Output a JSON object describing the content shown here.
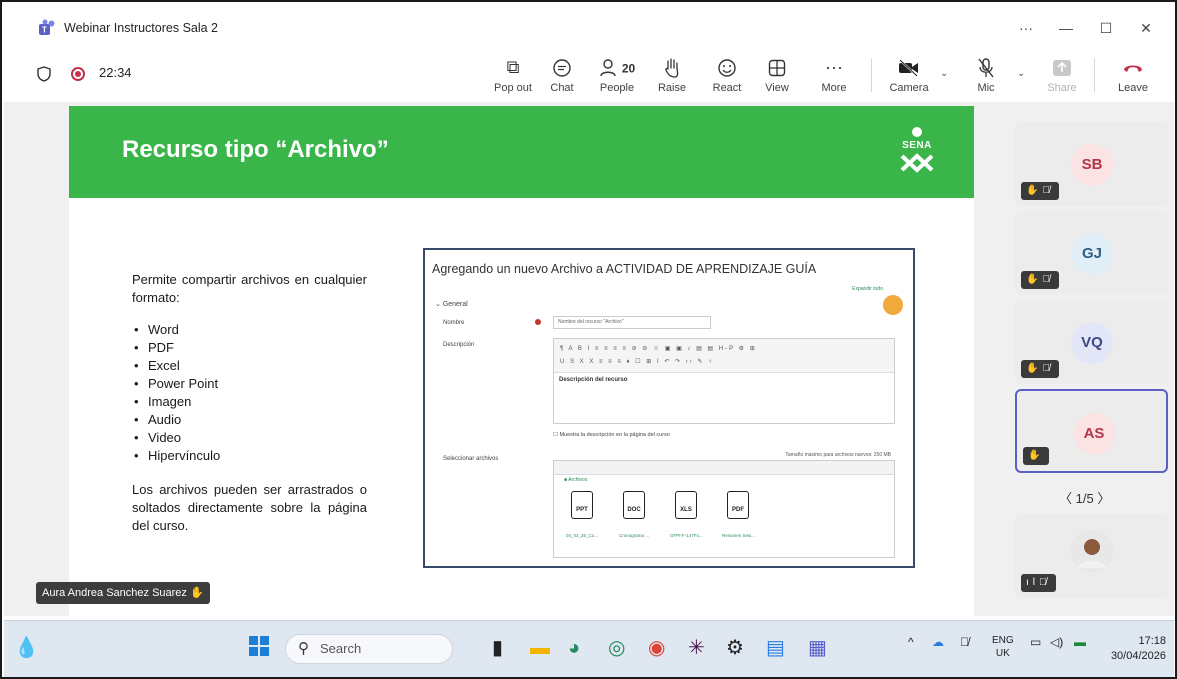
{
  "window": {
    "title": "Webinar Instructores Sala 2",
    "controls": [
      "···",
      "—",
      "☐",
      "✕"
    ]
  },
  "meeting": {
    "timer": "22:34",
    "buttons": [
      {
        "label": "Pop out",
        "icon": "pop-out-icon",
        "glyph": "⧉"
      },
      {
        "label": "Chat",
        "icon": "chat-icon",
        "glyph": "💬"
      },
      {
        "label": "People",
        "icon": "people-icon",
        "glyph": "👥",
        "count": "20"
      },
      {
        "label": "Raise",
        "icon": "raise-hand-icon",
        "glyph": "✋"
      },
      {
        "label": "React",
        "icon": "react-icon",
        "glyph": "☺"
      },
      {
        "label": "View",
        "icon": "view-icon",
        "glyph": "⊞"
      },
      {
        "label": "More",
        "icon": "more-icon",
        "glyph": "···"
      },
      {
        "label": "Camera",
        "icon": "camera-off-icon",
        "glyph": "📷"
      },
      {
        "label": "Mic",
        "icon": "mic-off-icon",
        "glyph": "🎙"
      },
      {
        "label": "Share",
        "icon": "share-icon",
        "glyph": "⇧"
      },
      {
        "label": "Leave",
        "icon": "leave-icon",
        "glyph": "☎"
      }
    ]
  },
  "slide": {
    "title": "Recurso tipo “Archivo”",
    "logo_text": "SENA",
    "intro": "Permite compartir archivos en cualquier formato:",
    "bullets": [
      "Word",
      "PDF",
      "Excel",
      "Power Point",
      "Imagen",
      "Audio",
      "Video",
      "Hipervínculo"
    ],
    "outro": "Los archivos pueden ser arrastrados o soltados directamente sobre la página del curso.",
    "moodle": {
      "heading": "Agregando un nuevo Archivo a ACTIVIDAD DE APRENDIZAJE GUÍA",
      "expand": "Expandir todo",
      "section": "General",
      "name_label": "Nombre",
      "name_value": "Nombre del recurso \"Archivo\"",
      "desc_label": "Descripción",
      "desc_value": "Descripción del recurso",
      "show_desc": "Muestra la descripción en la página del curso",
      "files_label": "Seleccionar archivos",
      "max_size": "Tamaño máximo para archivos nuevos: 250 MB",
      "folder": "Archivos",
      "files": [
        {
          "type": "PPT",
          "name": "04_03_26_Co..."
        },
        {
          "type": "DOC",
          "name": "Cronograma ..."
        },
        {
          "type": "XLS",
          "name": "GFPI-F-147Fo..."
        },
        {
          "type": "PDF",
          "name": "Resumen Sesi..."
        }
      ]
    }
  },
  "speaker_tag": "Aura Andrea Sanchez Suarez",
  "participants": [
    {
      "initials": "SB",
      "color": "#fbe3e3",
      "text_color": "#b3344b"
    },
    {
      "initials": "GJ",
      "color": "#e0eef7",
      "text_color": "#2f5f85"
    },
    {
      "initials": "VQ",
      "color": "#e3e6f7",
      "text_color": "#3d4a8a"
    },
    {
      "initials": "AS",
      "color": "#fbe3e3",
      "text_color": "#b3344b"
    },
    {
      "initials": "",
      "color": "#d9d0c4",
      "text_color": "#333333"
    }
  ],
  "pager": "1/5",
  "taskbar": {
    "search_placeholder": "Search",
    "lang_line1": "ENG",
    "lang_line2": "UK",
    "time": "17:18",
    "date": "30/04/2026"
  }
}
